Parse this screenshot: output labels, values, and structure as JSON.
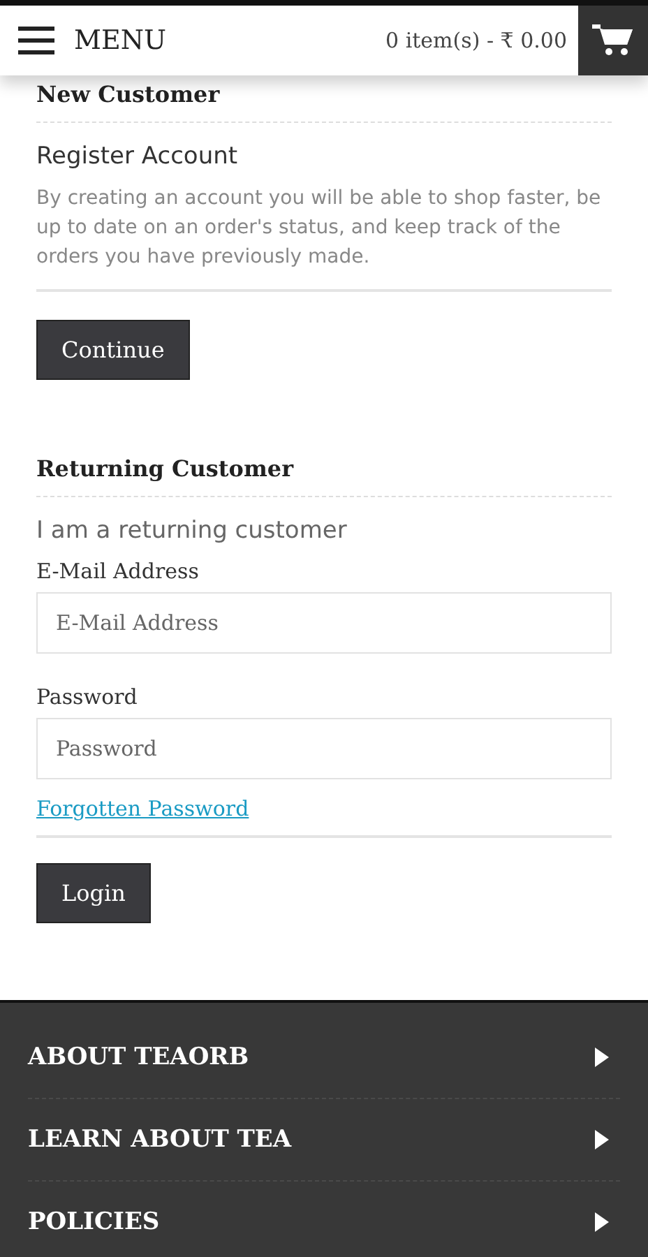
{
  "header": {
    "menu_label": "MENU",
    "cart_summary": "0 item(s) - ₹ 0.00"
  },
  "new_customer": {
    "title": "New Customer",
    "subtitle": "Register Account",
    "description": "By creating an account you will be able to shop faster, be up to date on an order's status, and keep track of the orders you have previously made.",
    "button": "Continue"
  },
  "returning_customer": {
    "title": "Returning Customer",
    "subtitle": "I am a returning customer",
    "fields": [
      {
        "label": "E-Mail Address",
        "placeholder": "E-Mail Address"
      },
      {
        "label": "Password",
        "placeholder": "Password"
      }
    ],
    "forgot_link": "Forgotten Password",
    "button": "Login"
  },
  "footer": {
    "items": [
      {
        "label": "ABOUT TEAORB"
      },
      {
        "label": "LEARN ABOUT TEA"
      },
      {
        "label": "POLICIES"
      }
    ]
  }
}
